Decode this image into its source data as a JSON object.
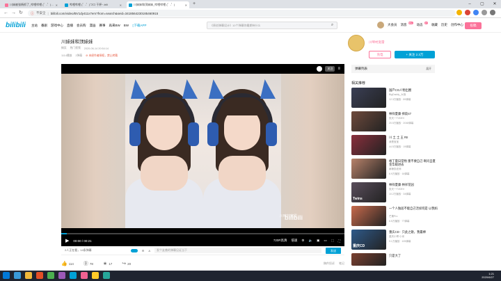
{
  "browser": {
    "tabs": [
      {
        "title": "川妹被张杨抓了_哔哩哔哩 (゜-゜)つロ",
        "color": "#fb7299",
        "active": false
      },
      {
        "title": "哔哩哔哩 (゜-゜)つロ 干杯~-bili",
        "color": "#00a1d6",
        "active": false
      },
      {
        "title": "川妹妹和顶妹妹_哔哩哔哩 (゜-゜)",
        "color": "#00a1d6",
        "active": true
      }
    ],
    "new_tab_label": "+",
    "url": "bilibili.com/video/BV1dy411x7em?from=search&seid=3418564230185460915",
    "security_label": "不安全"
  },
  "header": {
    "logo": "bilibili",
    "nav": [
      "主站",
      "番剧",
      "游戏中心",
      "直播",
      "会员购",
      "漫画",
      "赛事",
      "再来BW",
      "BW",
      "下载APP"
    ],
    "search_placeholder": "《原创弹幕设计》10个弹幕你最期待什么",
    "right_nav": [
      "大会员",
      "消息",
      "动态",
      "收藏",
      "历史",
      "创作中心"
    ],
    "badges": {
      "messages": "99+",
      "dynamic": "17"
    },
    "upload_label": "投稿"
  },
  "video": {
    "title": "川妹妹和顶妹妹",
    "meta1": [
      "搞笑",
      "热门视频",
      "2020-06-14 20:54:14"
    ],
    "views": "1114播放",
    "danmaku_count": "2弹幕",
    "warning": "未经作者授权，禁止转载",
    "watermark": "川啤村宽雷",
    "watermark_logo": "bilibili",
    "follow_label": "关注",
    "time_current": "00:00",
    "time_total": "00:21",
    "progress": 0.02,
    "quality": "720P高清",
    "speed": "倍速"
  },
  "danmaku_bar": {
    "watching": "2人正在看，14条弹幕",
    "input_placeholder": "发个友善的弹幕见证当下",
    "send_label": "发送"
  },
  "actions": {
    "like": "114",
    "coin": "78",
    "favorite": "17",
    "share": "20",
    "right": [
      "稿件投诉",
      "笔记"
    ]
  },
  "up": {
    "name": "川啤村宽雷",
    "charge_label": "充电",
    "follow_label": "+ 关注 2.3万"
  },
  "danmaku_list": {
    "title": "弹幕列表",
    "expand": "展开"
  },
  "related": {
    "header": "相关推荐",
    "items": [
      {
        "title": "国产CG人物出圈",
        "up": "BigDaddy_大咖",
        "stats": "12.3万播放 · 89弹幕",
        "color": "#3a3f55"
      },
      {
        "title": "林祥夏康·摔跤47",
        "up": "张天一TVDEV",
        "stats": "20.5万播放 · 2048弹幕",
        "color": "#6e4a3c"
      },
      {
        "title": "川 土 土 王 RII",
        "up": "我是宝宝",
        "stats": "44.5万播放 · 19弹幕",
        "color": "#8a2f3c"
      },
      {
        "title": "格丁雷日常物 重不要自己 啊问自夏金华殿进去",
        "up": "麻辣张老师",
        "stats": "6.9万播放 · 16弹幕",
        "color": "#b8826a"
      },
      {
        "title": "林祥夏康·林祥花园",
        "up": "张天一TVDEV",
        "stats": "10.2万播放 · 34弹幕",
        "color": "#5a4e5c",
        "label": "Twins"
      },
      {
        "title": "一个人独居不能自己活如何是 以我妈",
        "up": "芒果Pro",
        "stats": "6.5万播放 · 77弹幕",
        "color": "#c86a4c"
      },
      {
        "title": "重庆CD · 只此之歌，我最棒",
        "up": "重庆小哥·小米",
        "stats": "9.1万播放 · 105弹幕",
        "color": "#2f5a8a",
        "label": "重庆CD"
      },
      {
        "title": "只是大了",
        "up": "",
        "stats": "",
        "color": "#7a4030"
      }
    ]
  },
  "taskbar": {
    "time": "1:21",
    "date": "2020/6/27",
    "icons": [
      "#0078d7",
      "#3a9ad9",
      "#f2b83a",
      "#e34f26",
      "#4caf50",
      "#9b59b6",
      "#00a1d6",
      "#f06292",
      "#ffca28",
      "#26a69a"
    ]
  }
}
